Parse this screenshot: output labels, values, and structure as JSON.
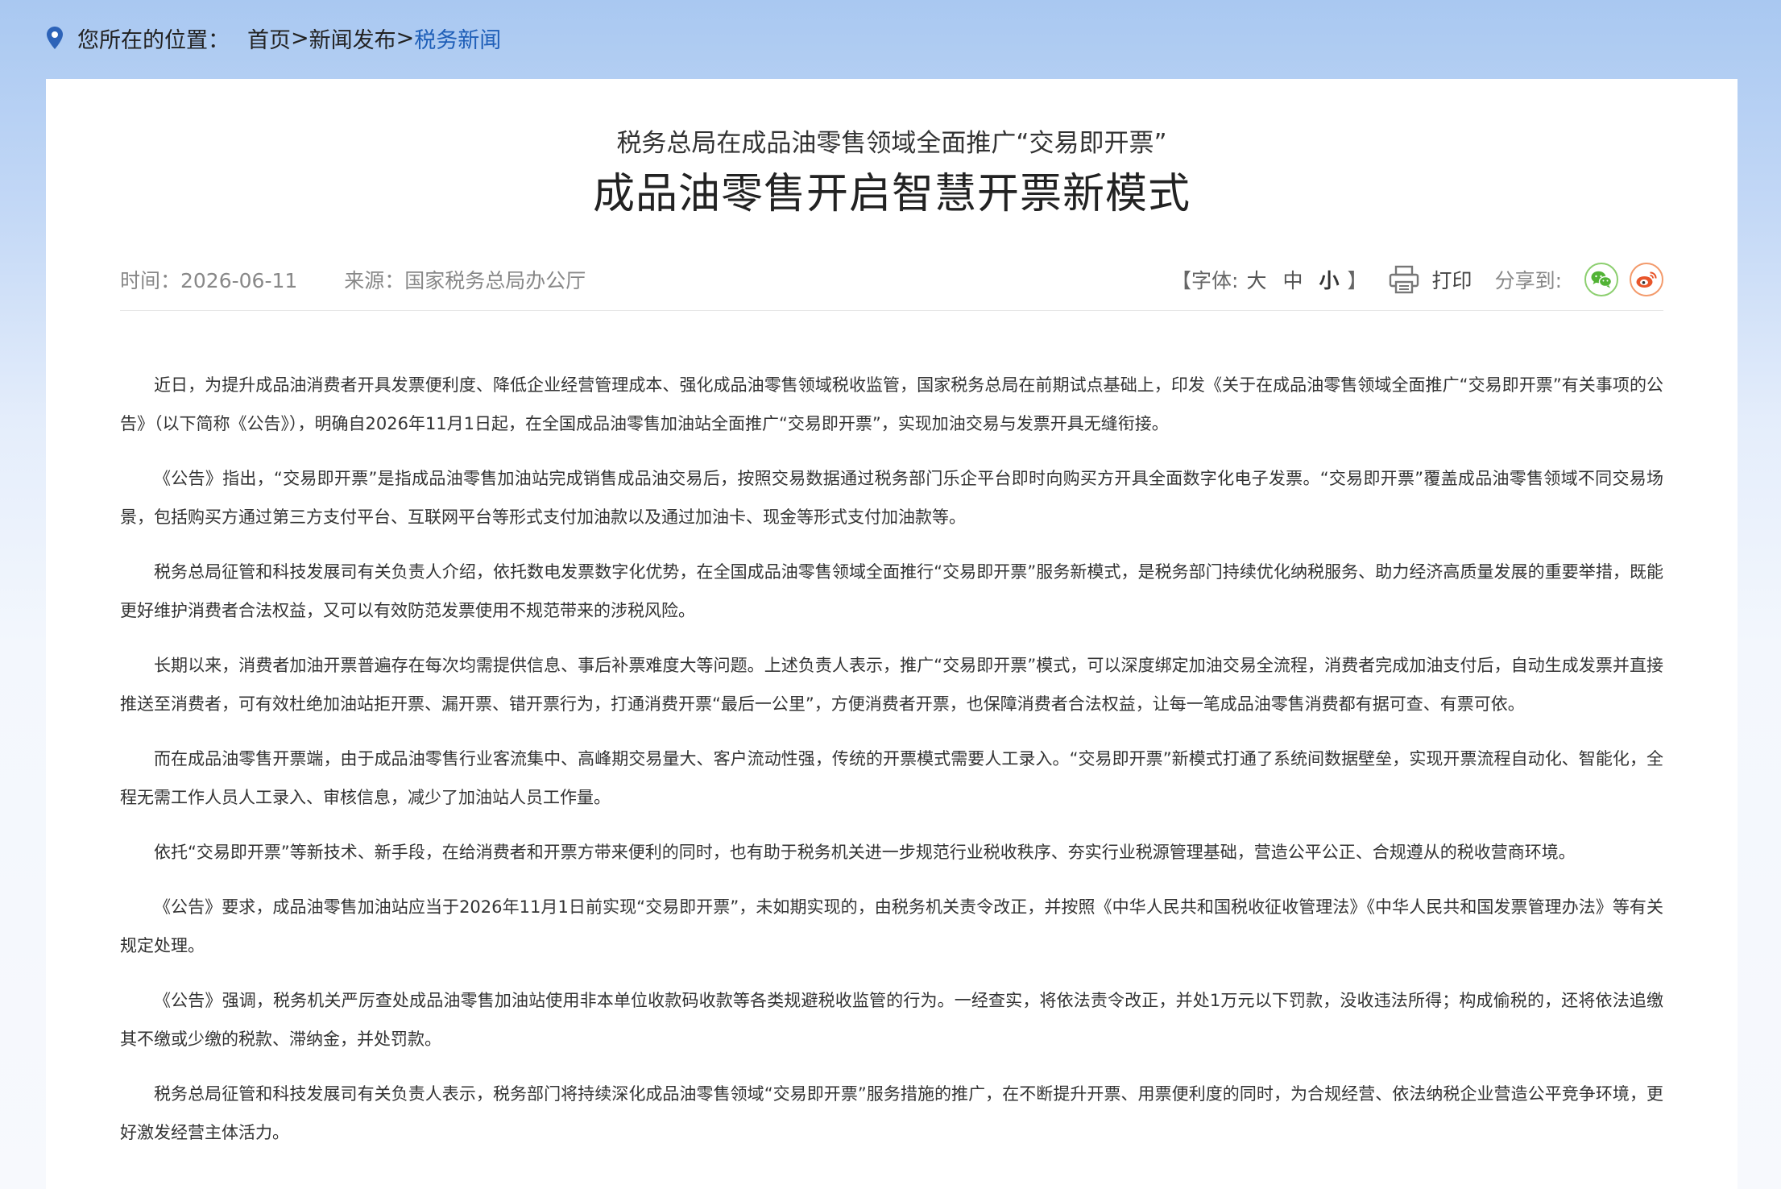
{
  "breadcrumb": {
    "label": "您所在的位置：",
    "items": [
      "首页",
      "新闻发布",
      "税务新闻"
    ],
    "separator": ">"
  },
  "article": {
    "subtitle": "税务总局在成品油零售领域全面推广“交易即开票”",
    "title": "成品油零售开启智慧开票新模式",
    "time": "时间：2026-06-11",
    "source": "来源：国家税务总局办公厅",
    "paragraphs": [
      "近日，为提升成品油消费者开具发票便利度、降低企业经营管理成本、强化成品油零售领域税收监管，国家税务总局在前期试点基础上，印发《关于在成品油零售领域全面推广“交易即开票”有关事项的公告》（以下简称《公告》），明确自2026年11月1日起，在全国成品油零售加油站全面推广“交易即开票”，实现加油交易与发票开具无缝衔接。",
      "《公告》指出，“交易即开票”是指成品油零售加油站完成销售成品油交易后，按照交易数据通过税务部门乐企平台即时向购买方开具全面数字化电子发票。“交易即开票”覆盖成品油零售领域不同交易场景，包括购买方通过第三方支付平台、互联网平台等形式支付加油款以及通过加油卡、现金等形式支付加油款等。",
      "税务总局征管和科技发展司有关负责人介绍，依托数电发票数字化优势，在全国成品油零售领域全面推行“交易即开票”服务新模式，是税务部门持续优化纳税服务、助力经济高质量发展的重要举措，既能更好维护消费者合法权益，又可以有效防范发票使用不规范带来的涉税风险。",
      "长期以来，消费者加油开票普遍存在每次均需提供信息、事后补票难度大等问题。上述负责人表示，推广“交易即开票”模式，可以深度绑定加油交易全流程，消费者完成加油支付后，自动生成发票并直接推送至消费者，可有效杜绝加油站拒开票、漏开票、错开票行为，打通消费开票“最后一公里”，方便消费者开票，也保障消费者合法权益，让每一笔成品油零售消费都有据可查、有票可依。",
      "而在成品油零售开票端，由于成品油零售行业客流集中、高峰期交易量大、客户流动性强，传统的开票模式需要人工录入。“交易即开票”新模式打通了系统间数据壁垒，实现开票流程自动化、智能化，全程无需工作人员人工录入、审核信息，减少了加油站人员工作量。",
      "依托“交易即开票”等新技术、新手段，在给消费者和开票方带来便利的同时，也有助于税务机关进一步规范行业税收秩序、夯实行业税源管理基础，营造公平公正、合规遵从的税收营商环境。",
      "《公告》要求，成品油零售加油站应当于2026年11月1日前实现“交易即开票”，未如期实现的，由税务机关责令改正，并按照《中华人民共和国税收征收管理法》《中华人民共和国发票管理办法》等有关规定处理。",
      "《公告》强调，税务机关严厉查处成品油零售加油站使用非本单位收款码收款等各类规避税收监管的行为。一经查实，将依法责令改正，并处1万元以下罚款，没收违法所得；构成偷税的，还将依法追缴其不缴或少缴的税款、滞纳金，并处罚款。",
      "税务总局征管和科技发展司有关负责人表示，税务部门将持续深化成品油零售领域“交易即开票”服务措施的推广，在不断提升开票、用票便利度的同时，为合规经营、依法纳税企业营造公平竞争环境，更好激发经营主体活力。"
    ]
  },
  "tools": {
    "font_open": "【字体:",
    "font_large": "大",
    "font_medium": "中",
    "font_small": "小",
    "font_close": "】",
    "print_label": "打印",
    "share_label": "分享到:",
    "share_targets": [
      "wechat-icon",
      "weibo-icon"
    ]
  },
  "colors": {
    "accent": "#1f5fb8",
    "pin": "#2d63b8",
    "wechat": "#52b335",
    "weibo": "#e8552a"
  }
}
